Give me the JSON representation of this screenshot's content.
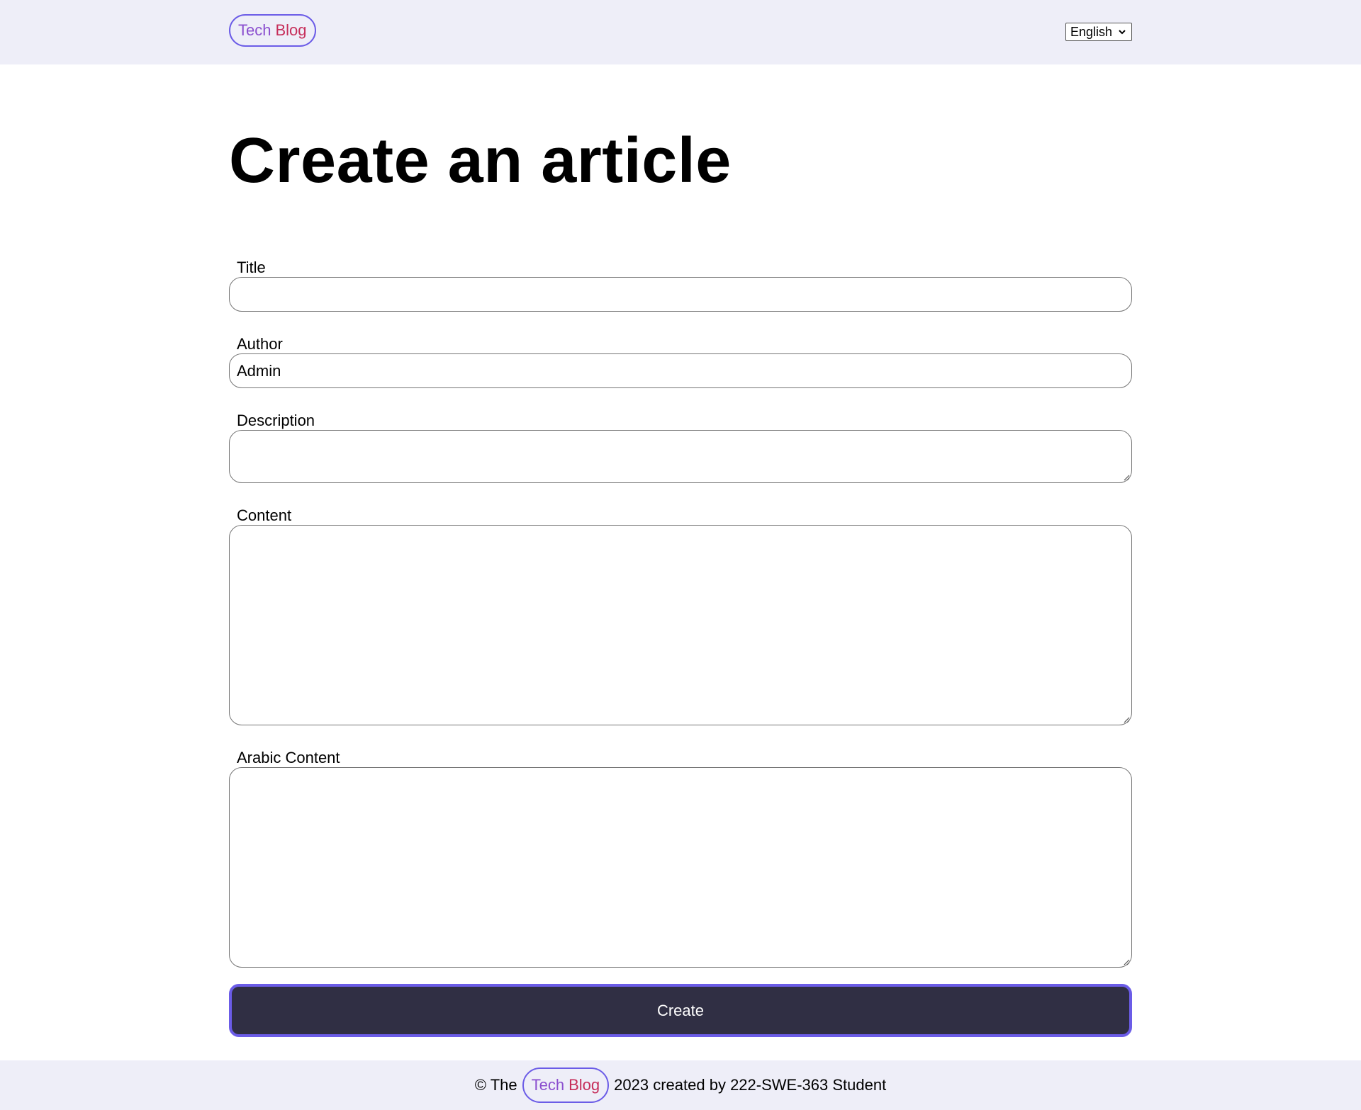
{
  "header": {
    "logo": {
      "word1": "Tech",
      "word2": "Blog"
    },
    "language": {
      "selected": "English"
    }
  },
  "page": {
    "title": "Create an article"
  },
  "form": {
    "title": {
      "label": "Title",
      "value": ""
    },
    "author": {
      "label": "Author",
      "value": "Admin"
    },
    "description": {
      "label": "Description",
      "value": ""
    },
    "content": {
      "label": "Content",
      "value": ""
    },
    "arabic_content": {
      "label": "Arabic Content",
      "value": ""
    },
    "submit_label": "Create"
  },
  "footer": {
    "prefix": "© The",
    "logo": {
      "word1": "Tech",
      "word2": "Blog"
    },
    "suffix": "2023 created by 222-SWE-363 Student"
  },
  "colors": {
    "header_bg": "#eeeef8",
    "accent_border": "#6b5ce7",
    "logo_word1": "#8b4fcf",
    "logo_word2": "#c62e5a",
    "button_bg": "#302f44"
  }
}
